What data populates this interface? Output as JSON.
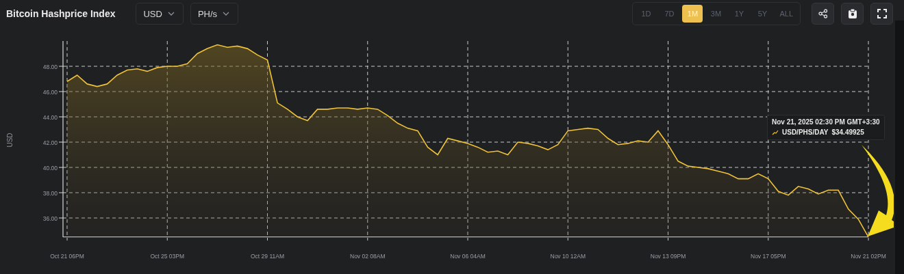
{
  "title": "Bitcoin Hashprice Index",
  "currency_select": {
    "value": "USD"
  },
  "unit_select": {
    "value": "PH/s"
  },
  "ranges": [
    {
      "label": "1D",
      "selected": false
    },
    {
      "label": "7D",
      "selected": false
    },
    {
      "label": "1M",
      "selected": true
    },
    {
      "label": "3M",
      "selected": false
    },
    {
      "label": "1Y",
      "selected": false
    },
    {
      "label": "5Y",
      "selected": false
    },
    {
      "label": "ALL",
      "selected": false
    }
  ],
  "chart_data": {
    "type": "area",
    "grid": true,
    "ylabel": "USD",
    "ylim": [
      34.5,
      50
    ],
    "categories": [
      "Oct 21 06PM",
      null,
      null,
      null,
      null,
      null,
      null,
      null,
      null,
      null,
      "Oct 25 03PM",
      null,
      null,
      null,
      null,
      null,
      null,
      null,
      null,
      null,
      "Oct 29 11AM",
      null,
      null,
      null,
      null,
      null,
      null,
      null,
      null,
      null,
      "Nov 02 08AM",
      null,
      null,
      null,
      null,
      null,
      null,
      null,
      null,
      null,
      "Nov 06 04AM",
      null,
      null,
      null,
      null,
      null,
      null,
      null,
      null,
      null,
      "Nov 10 12AM",
      null,
      null,
      null,
      null,
      null,
      null,
      null,
      null,
      null,
      "Nov 13 09PM",
      null,
      null,
      null,
      null,
      null,
      null,
      null,
      null,
      null,
      "Nov 17 05PM",
      null,
      null,
      null,
      null,
      null,
      null,
      null,
      null,
      null,
      "Nov 21 02PM"
    ],
    "series": [
      {
        "name": "USD/PHS/DAY",
        "color": "#f0c23a",
        "values": [
          46.8,
          47.3,
          46.6,
          46.4,
          46.6,
          47.3,
          47.7,
          47.8,
          47.6,
          47.9,
          48.0,
          48.0,
          48.2,
          49.0,
          49.4,
          49.7,
          49.5,
          49.6,
          49.4,
          48.9,
          48.5,
          45.1,
          44.6,
          44.0,
          43.7,
          44.6,
          44.6,
          44.7,
          44.7,
          44.6,
          44.7,
          44.6,
          44.1,
          43.5,
          43.1,
          42.9,
          41.6,
          41.0,
          42.3,
          42.1,
          41.9,
          41.6,
          41.2,
          41.3,
          41.0,
          42.0,
          41.9,
          41.7,
          41.4,
          41.8,
          42.9,
          43.0,
          43.1,
          43.0,
          42.3,
          41.8,
          41.9,
          42.1,
          42.0,
          42.9,
          41.8,
          40.5,
          40.1,
          40.0,
          39.9,
          39.7,
          39.5,
          39.1,
          39.1,
          39.5,
          39.1,
          38.1,
          37.8,
          38.5,
          38.3,
          37.9,
          38.2,
          38.2,
          36.7,
          35.9,
          34.5
        ]
      }
    ],
    "yticks": [
      {
        "value": 36,
        "label": "36.00"
      },
      {
        "value": 38,
        "label": "38.00"
      },
      {
        "value": 40,
        "label": "40.00"
      },
      {
        "value": 42,
        "label": "42.00"
      },
      {
        "value": 44,
        "label": "44.00"
      },
      {
        "value": 46,
        "label": "46.00"
      },
      {
        "value": 48,
        "label": "48.00"
      }
    ]
  },
  "tooltip": {
    "time": "Nov 21, 2025 02:30 PM GMT+3:30",
    "value": "$34.49925"
  }
}
